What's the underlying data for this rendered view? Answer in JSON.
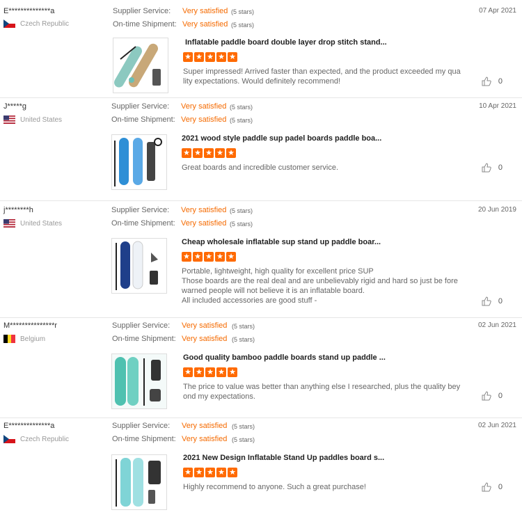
{
  "labels": {
    "service": "Supplier Service:",
    "shipment": "On-time Shipment:"
  },
  "colors": {
    "accent": "#f56a00",
    "star": "#ff6a00"
  },
  "reviews": [
    {
      "user": "E**************a",
      "country": "Czech Republic",
      "flag": "cz",
      "service_value": "Very satisfied",
      "service_stars": "(5 stars)",
      "shipment_value": "Very satisfied",
      "shipment_stars": "(5 stars)",
      "date": "07 Apr 2021",
      "product_title": "Inflatable paddle board double layer drop stitch stand...",
      "rating": 5,
      "text": [
        "Super impressed! Arrived faster than expected, and the product exceeded my qua",
        "lity expectations. Would definitely recommend!"
      ],
      "likes": "0"
    },
    {
      "user": "J*****g",
      "country": "United States",
      "flag": "us",
      "service_value": "Very satisfied",
      "service_stars": "(5 stars)",
      "shipment_value": "Very satisfied",
      "shipment_stars": "(5 stars)",
      "date": "10 Apr 2021",
      "product_title": "2021 wood style paddle sup padel boards paddle boa...",
      "rating": 5,
      "text": [
        "Great boards and incredible customer service."
      ],
      "likes": "0"
    },
    {
      "user": "j********h",
      "country": "United States",
      "flag": "us",
      "service_value": "Very satisfied",
      "service_stars": "(5 stars)",
      "shipment_value": "Very satisfied",
      "shipment_stars": "(5 stars)",
      "date": "20 Jun 2019",
      "product_title": "Cheap wholesale inflatable sup stand up paddle boar...",
      "rating": 5,
      "text": [
        "Portable, lightweight, high quality for excellent price SUP",
        "Those boards are the real deal and are unbelievably rigid and hard so just be fore",
        "warned people will not believe it is an inflatable board.",
        "All included accessories are good stuff -"
      ],
      "likes": "0"
    },
    {
      "user": "M***************r",
      "country": "Belgium",
      "flag": "be",
      "service_value": "Very satisfied",
      "service_stars": "(5 stars)",
      "shipment_value": "Very satisfied",
      "shipment_stars": "(5 stars)",
      "date": "02 Jun 2021",
      "product_title": "Good quality bamboo paddle boards stand up paddle ...",
      "rating": 5,
      "text": [
        "The price to value was better than anything else I researched, plus the quality bey",
        "ond my expectations."
      ],
      "likes": "0"
    },
    {
      "user": "E**************a",
      "country": "Czech Republic",
      "flag": "cz",
      "service_value": "Very satisfied",
      "service_stars": "(5 stars)",
      "shipment_value": "Very satisfied",
      "shipment_stars": "(5 stars)",
      "date": "02 Jun 2021",
      "product_title": "2021 New Design Inflatable Stand Up paddles board s...",
      "rating": 5,
      "text": [
        "Highly recommend to anyone. Such a great purchase!"
      ],
      "likes": "0"
    }
  ]
}
